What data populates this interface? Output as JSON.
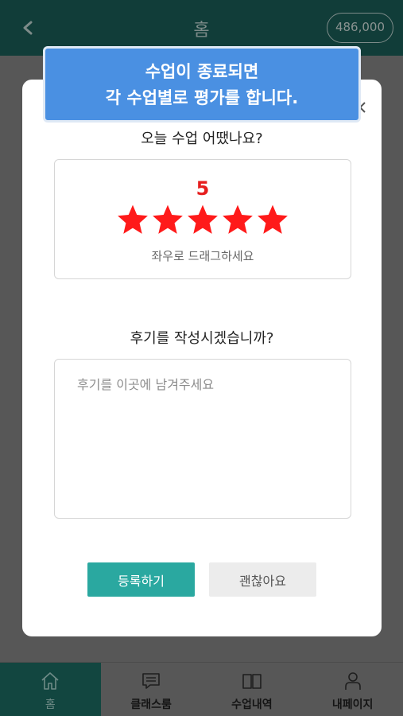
{
  "header": {
    "back_icon": "chevron-left-icon",
    "title": "홈",
    "points": "486,000"
  },
  "tooltip": {
    "line1": "수업이 종료되면",
    "line2": "각 수업별로 평가를 합니다."
  },
  "modal": {
    "close_icon": "close-icon",
    "question_rating": "오늘 수업 어땠나요?",
    "rating": {
      "value": "5",
      "stars_filled": 5,
      "stars_total": 5,
      "star_color": "#ff1a1a",
      "hint": "좌우로 드래그하세요"
    },
    "question_review": "후기를 작성시겠습니까?",
    "review": {
      "placeholder": "후기를 이곳에 남겨주세요",
      "value": ""
    },
    "submit_label": "등록하기",
    "cancel_label": "괜찮아요",
    "submit_color": "#2aa8a0"
  },
  "bottom_nav": {
    "items": [
      {
        "label": "홈",
        "icon": "home-icon",
        "active": true
      },
      {
        "label": "클래스룸",
        "icon": "chat-icon",
        "active": false
      },
      {
        "label": "수업내역",
        "icon": "book-icon",
        "active": false
      },
      {
        "label": "내페이지",
        "icon": "person-icon",
        "active": false
      }
    ]
  }
}
